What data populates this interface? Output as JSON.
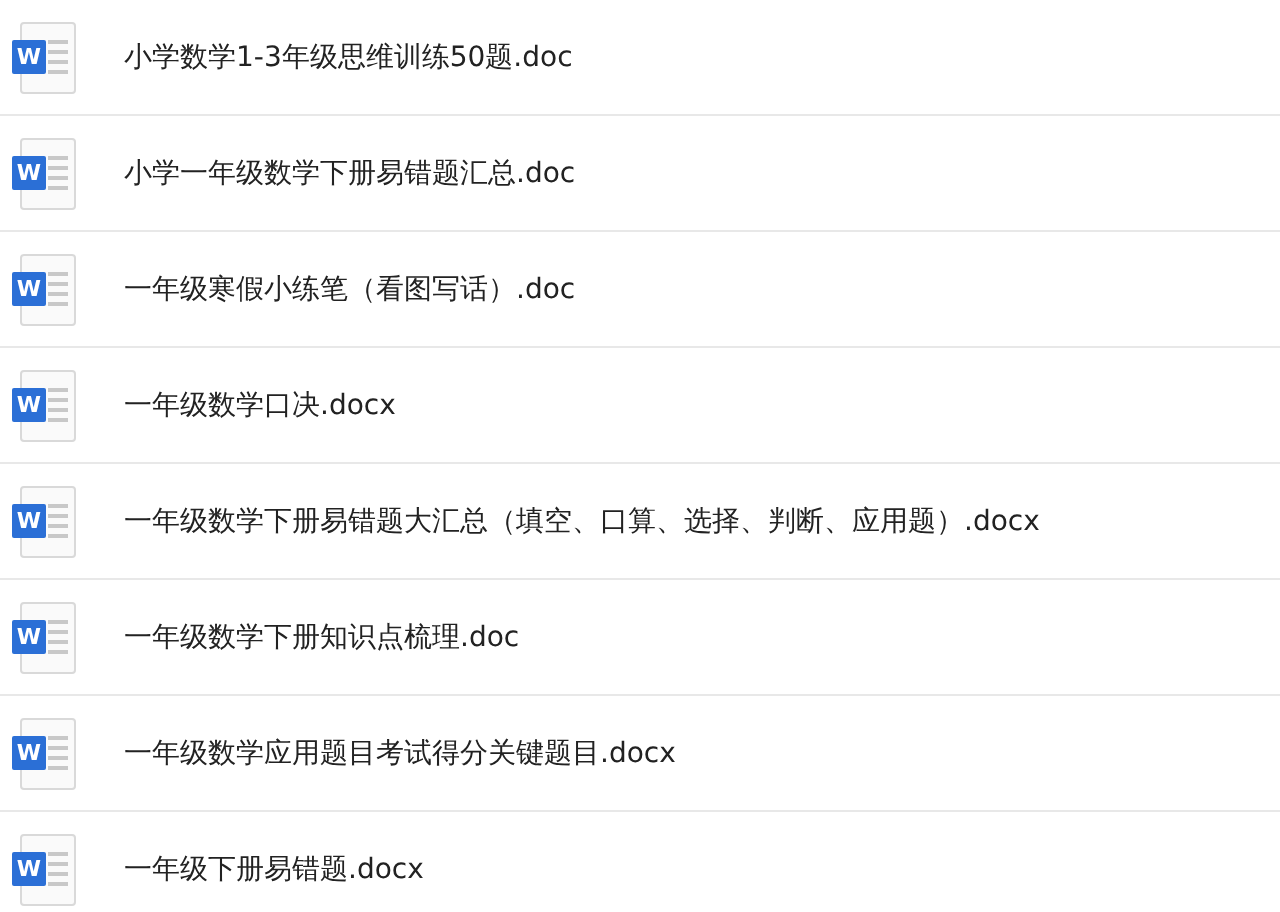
{
  "files": [
    {
      "icon_label": "W",
      "name": "小学数学1-3年级思维训练50题.doc"
    },
    {
      "icon_label": "W",
      "name": "小学一年级数学下册易错题汇总.doc"
    },
    {
      "icon_label": "W",
      "name": "一年级寒假小练笔（看图写话）.doc"
    },
    {
      "icon_label": "W",
      "name": "一年级数学口决.docx"
    },
    {
      "icon_label": "W",
      "name": "一年级数学下册易错题大汇总（填空、口算、选择、判断、应用题）.docx"
    },
    {
      "icon_label": "W",
      "name": "一年级数学下册知识点梳理.doc"
    },
    {
      "icon_label": "W",
      "name": "一年级数学应用题目考试得分关键题目.docx"
    },
    {
      "icon_label": "W",
      "name": "一年级下册易错题.docx"
    }
  ]
}
